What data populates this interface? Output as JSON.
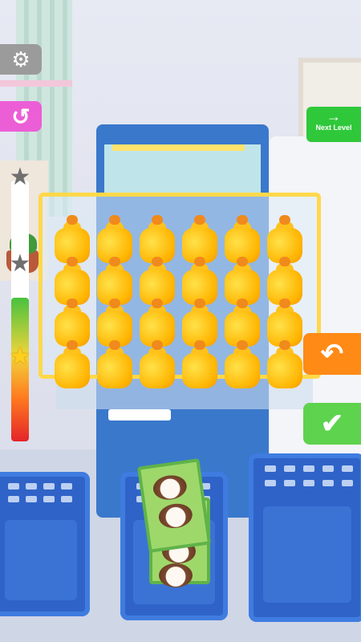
{
  "game": {
    "buttons": {
      "settings_icon": "⚙",
      "restart_icon": "↺",
      "next_level_arrow": "→",
      "next_level_label": "Next Level",
      "undo_icon": "↶",
      "confirm_icon": "✔"
    },
    "progress": {
      "fill_fraction": 0.55,
      "stars": [
        {
          "name": "star-top",
          "achieved": false
        },
        {
          "name": "star-middle",
          "achieved": false
        },
        {
          "name": "star-bottom",
          "achieved": true
        }
      ]
    },
    "crate": {
      "item": "juice-bottle",
      "rows": 4,
      "cols": 6
    },
    "baskets": [
      {
        "name": "basket-left",
        "contents": []
      },
      {
        "name": "basket-middle",
        "contents": [
          "coconut-box",
          "coconut-box"
        ]
      },
      {
        "name": "basket-right",
        "contents": []
      }
    ],
    "colors": {
      "bottle": "#ffc21d",
      "cap": "#f08a1c",
      "crate_frame": "#ffd84a",
      "next_level": "#2fc83a",
      "undo": "#ff8a16",
      "confirm": "#5ed34e",
      "restart": "#ec5ed6",
      "settings": "#9b9b9b",
      "basket": "#2f63c8"
    }
  }
}
